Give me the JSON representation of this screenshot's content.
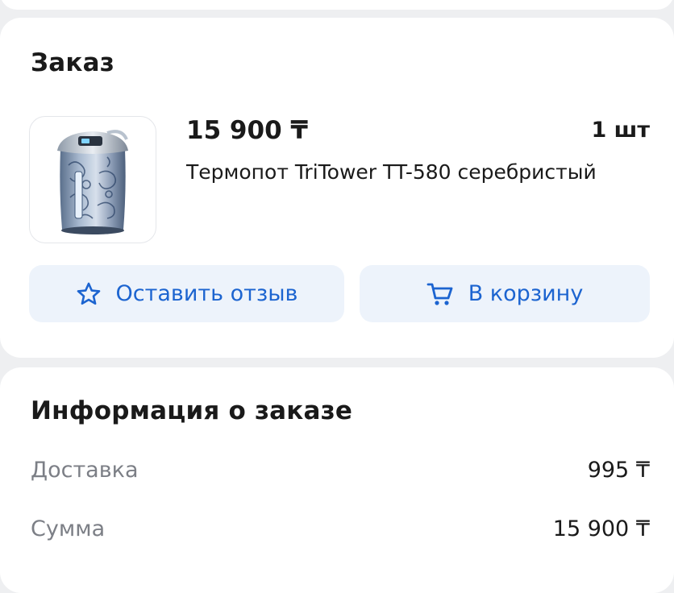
{
  "order": {
    "title": "Заказ",
    "item": {
      "price": "15 900 ₸",
      "quantity": "1 шт",
      "name": "Термопот TriTower TT-580 серебристый",
      "image_icon": "thermopot-product-image"
    },
    "buttons": {
      "review_label": "Оставить отзыв",
      "review_icon": "star-icon",
      "cart_label": "В корзину",
      "cart_icon": "cart-icon"
    }
  },
  "info": {
    "title": "Информация о заказе",
    "rows": [
      {
        "label": "Доставка",
        "value": "995 ₸"
      },
      {
        "label": "Сумма",
        "value": "15 900 ₸"
      }
    ]
  },
  "colors": {
    "accent": "#1c64d0",
    "button_bg": "#edf3fb",
    "page_bg": "#eeeff1",
    "card_bg": "#ffffff",
    "muted_text": "#7c7f86"
  }
}
